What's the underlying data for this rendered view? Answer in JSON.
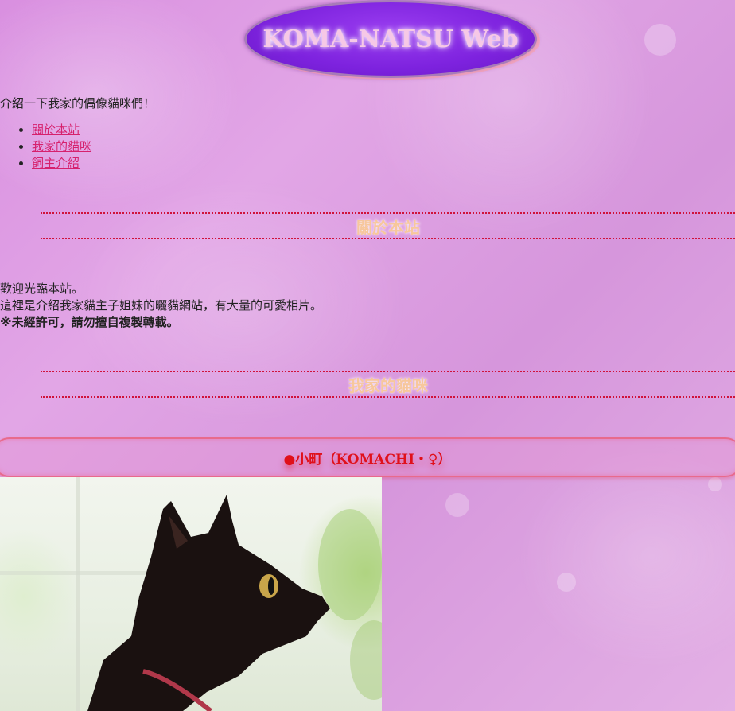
{
  "header": {
    "logo_text": "KOMA-NATSU Web"
  },
  "intro": "介紹一下我家的偶像貓咪們！",
  "nav": {
    "items": [
      {
        "label": "關於本站"
      },
      {
        "label": "我家的貓咪"
      },
      {
        "label": "飼主介紹"
      }
    ]
  },
  "about": {
    "heading": "關於本站",
    "line1": "歡迎光臨本站。",
    "line2": "這裡是介紹我家貓主子姐妹的曬貓網站，有大量的可愛相片。",
    "line3": "※未經許可，請勿擅自複製轉載。"
  },
  "cats": {
    "heading": "我家的貓咪",
    "cat1_title": "●小町（KOMACHI・♀）"
  },
  "colors": {
    "logo_bg": "#7d22de",
    "link": "#d6216d",
    "heading_text": "#f7c79c",
    "cat_title": "#e0101a"
  }
}
